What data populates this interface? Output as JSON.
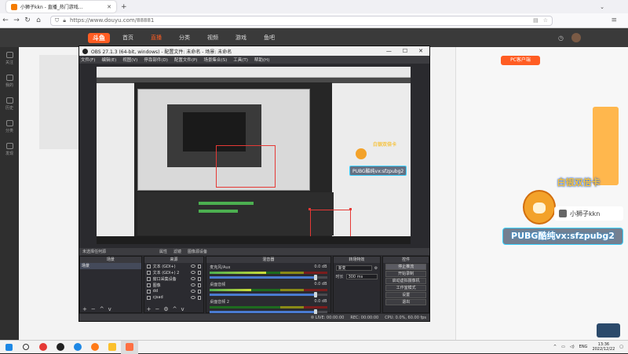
{
  "browser": {
    "tab_title": "小狮子kkn - 直播_热门游戏...",
    "tab_close": "✕",
    "new_tab": "+",
    "url": "https://www.douyu.com/88881",
    "icons": [
      "back-icon",
      "forward-icon",
      "reload-icon",
      "home-icon",
      "lock-icon",
      "star-icon",
      "menu-icon"
    ]
  },
  "site": {
    "logo": "斗鱼",
    "nav": [
      "首页",
      "直播",
      "分类",
      "视频",
      "游戏",
      "鱼吧"
    ],
    "nav_active_index": 1,
    "left_sidebar": [
      "关注",
      "我的",
      "历史",
      "分类",
      "发现"
    ],
    "pc_button": "PC客户端",
    "silver_card": "白银双倍卡",
    "badge_name": "小狮子kkn",
    "pubg_banner": "PUBG酷纯vx:sfzpubg2",
    "colors": {
      "accent": "#ff5d23",
      "banner_border": "#3bd2ff",
      "gold": "#f6c33f"
    }
  },
  "obs": {
    "title": "OBS 27.1.3 (64-bit, windows) - 配置文件: 未命名 - 场景: 未命名",
    "window_controls": [
      "—",
      "☐",
      "✕"
    ],
    "menu": [
      "文件(F)",
      "编辑(E)",
      "视图(V)",
      "停靠部件(D)",
      "配置文件(P)",
      "场景集合(S)",
      "工具(T)",
      "帮助(H)"
    ],
    "preview_bar": [
      "未选择任何源",
      "属性",
      "滤镜",
      "图像源设备"
    ],
    "docks": {
      "scenes": {
        "title": "场景",
        "items": [
          "场景"
        ]
      },
      "sources": {
        "title": "来源",
        "items": [
          "文本 (GDI+)",
          "文本 (GDI+) 2",
          "窗口采集设备",
          "图像",
          "dd",
          "cjsad"
        ]
      },
      "mixer": {
        "title": "混音器",
        "channels": [
          {
            "name": "麦克风/Aux",
            "db": "0.0 dB",
            "level": 0.48,
            "volume": 0.9
          },
          {
            "name": "桌面音频",
            "db": "0.0 dB",
            "level": 0.35,
            "volume": 0.9
          },
          {
            "name": "桌面音频 2",
            "db": "0.0 dB",
            "level": 0.0,
            "volume": 0.9
          }
        ]
      },
      "transitions": {
        "title": "转场特效",
        "type": "渐变",
        "duration_label": "时长",
        "duration": "300 ms"
      },
      "controls": {
        "title": "控件",
        "buttons": [
          "停止推流",
          "开始录制",
          "启动虚拟摄像机",
          "工作室模式",
          "设置",
          "退出"
        ],
        "active_index": 0
      }
    },
    "status": {
      "live": "LIVE: 00:00:00",
      "rec": "REC: 00:00:00",
      "cpu": "CPU: 0.0%, 60.00 fps"
    }
  },
  "taskbar": {
    "apps": [
      "start-icon",
      "search-icon",
      "browser-icon",
      "obs-icon",
      "edge-icon",
      "firefox-icon",
      "folder-icon",
      "obs-active-icon"
    ],
    "lang": "ENG",
    "time": "13:36",
    "date": "2022/12/22"
  }
}
